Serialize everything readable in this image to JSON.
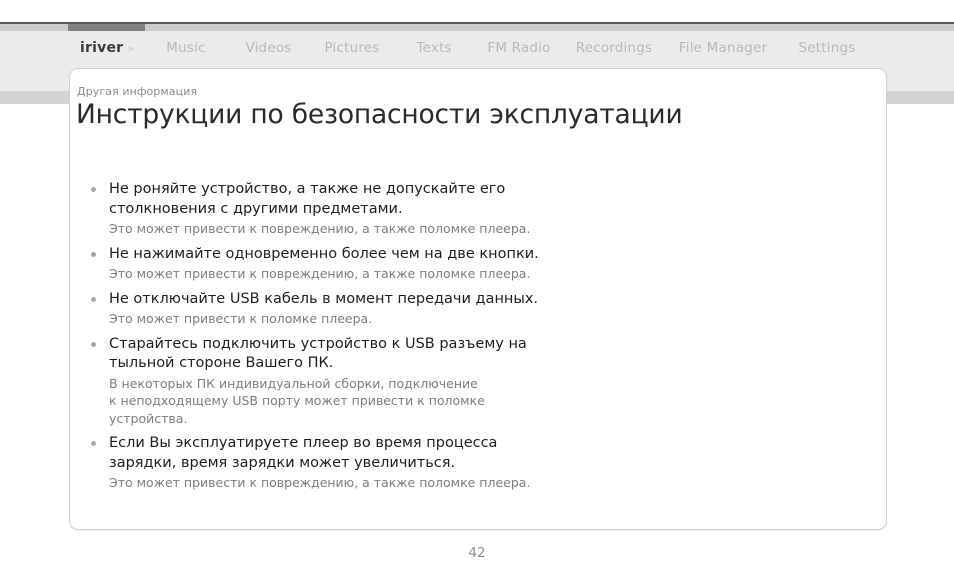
{
  "chrome": {
    "active_tab_marker": "active-tab-indicator"
  },
  "navbar": {
    "brand": {
      "label": "iriver",
      "arrows": "»"
    },
    "items": [
      {
        "label": "Music"
      },
      {
        "label": "Videos"
      },
      {
        "label": "Pictures"
      },
      {
        "label": "Texts"
      },
      {
        "label": "FM Radio"
      },
      {
        "label": "Recordings"
      },
      {
        "label": "File Manager"
      },
      {
        "label": "Settings"
      }
    ]
  },
  "page": {
    "eyebrow": "Другая информация",
    "title": "Инструкции по безопасности эксплуатации",
    "page_number": "42"
  },
  "safety_list": [
    {
      "main": "Не роняйте устройство, а также не допускайте его\nстолкновения с другими предметами.",
      "sub": "Это может привести к повреждению, а также поломке плеера."
    },
    {
      "main": "Не нажимайте одновременно более чем на две кнопки.",
      "sub": "Это может привести к повреждению, а также поломке плеера."
    },
    {
      "main": "Не отключайте USB кабель в момент передачи данных.",
      "sub": "Это может привести к поломке плеера."
    },
    {
      "main": "Старайтесь подключить устройство к USB разъему на\nтыльной стороне Вашего ПК.",
      "sub": "В некоторых ПК индивидуальной сборки, подключение\nк неподходящему USB порту может привести к поломке\nустройства."
    },
    {
      "main": "Если Вы эксплуатируете плеер во время процесса\nзарядки, время зарядки может увеличиться.",
      "sub": "Это может привести к повреждению, а также поломке плеера."
    }
  ],
  "colors": {
    "rule": "#585858",
    "tab_strip": "#cccccc",
    "tab_active": "#828282",
    "nav_band": "#ebebeb",
    "nav_shelf": "#d4d4d4",
    "card_border": "#cfcfcf",
    "title_text": "#2a2a2a",
    "body_text": "#1e1e1e",
    "sub_text": "#7d7d7d",
    "nav_text": "#b9b9b9"
  }
}
